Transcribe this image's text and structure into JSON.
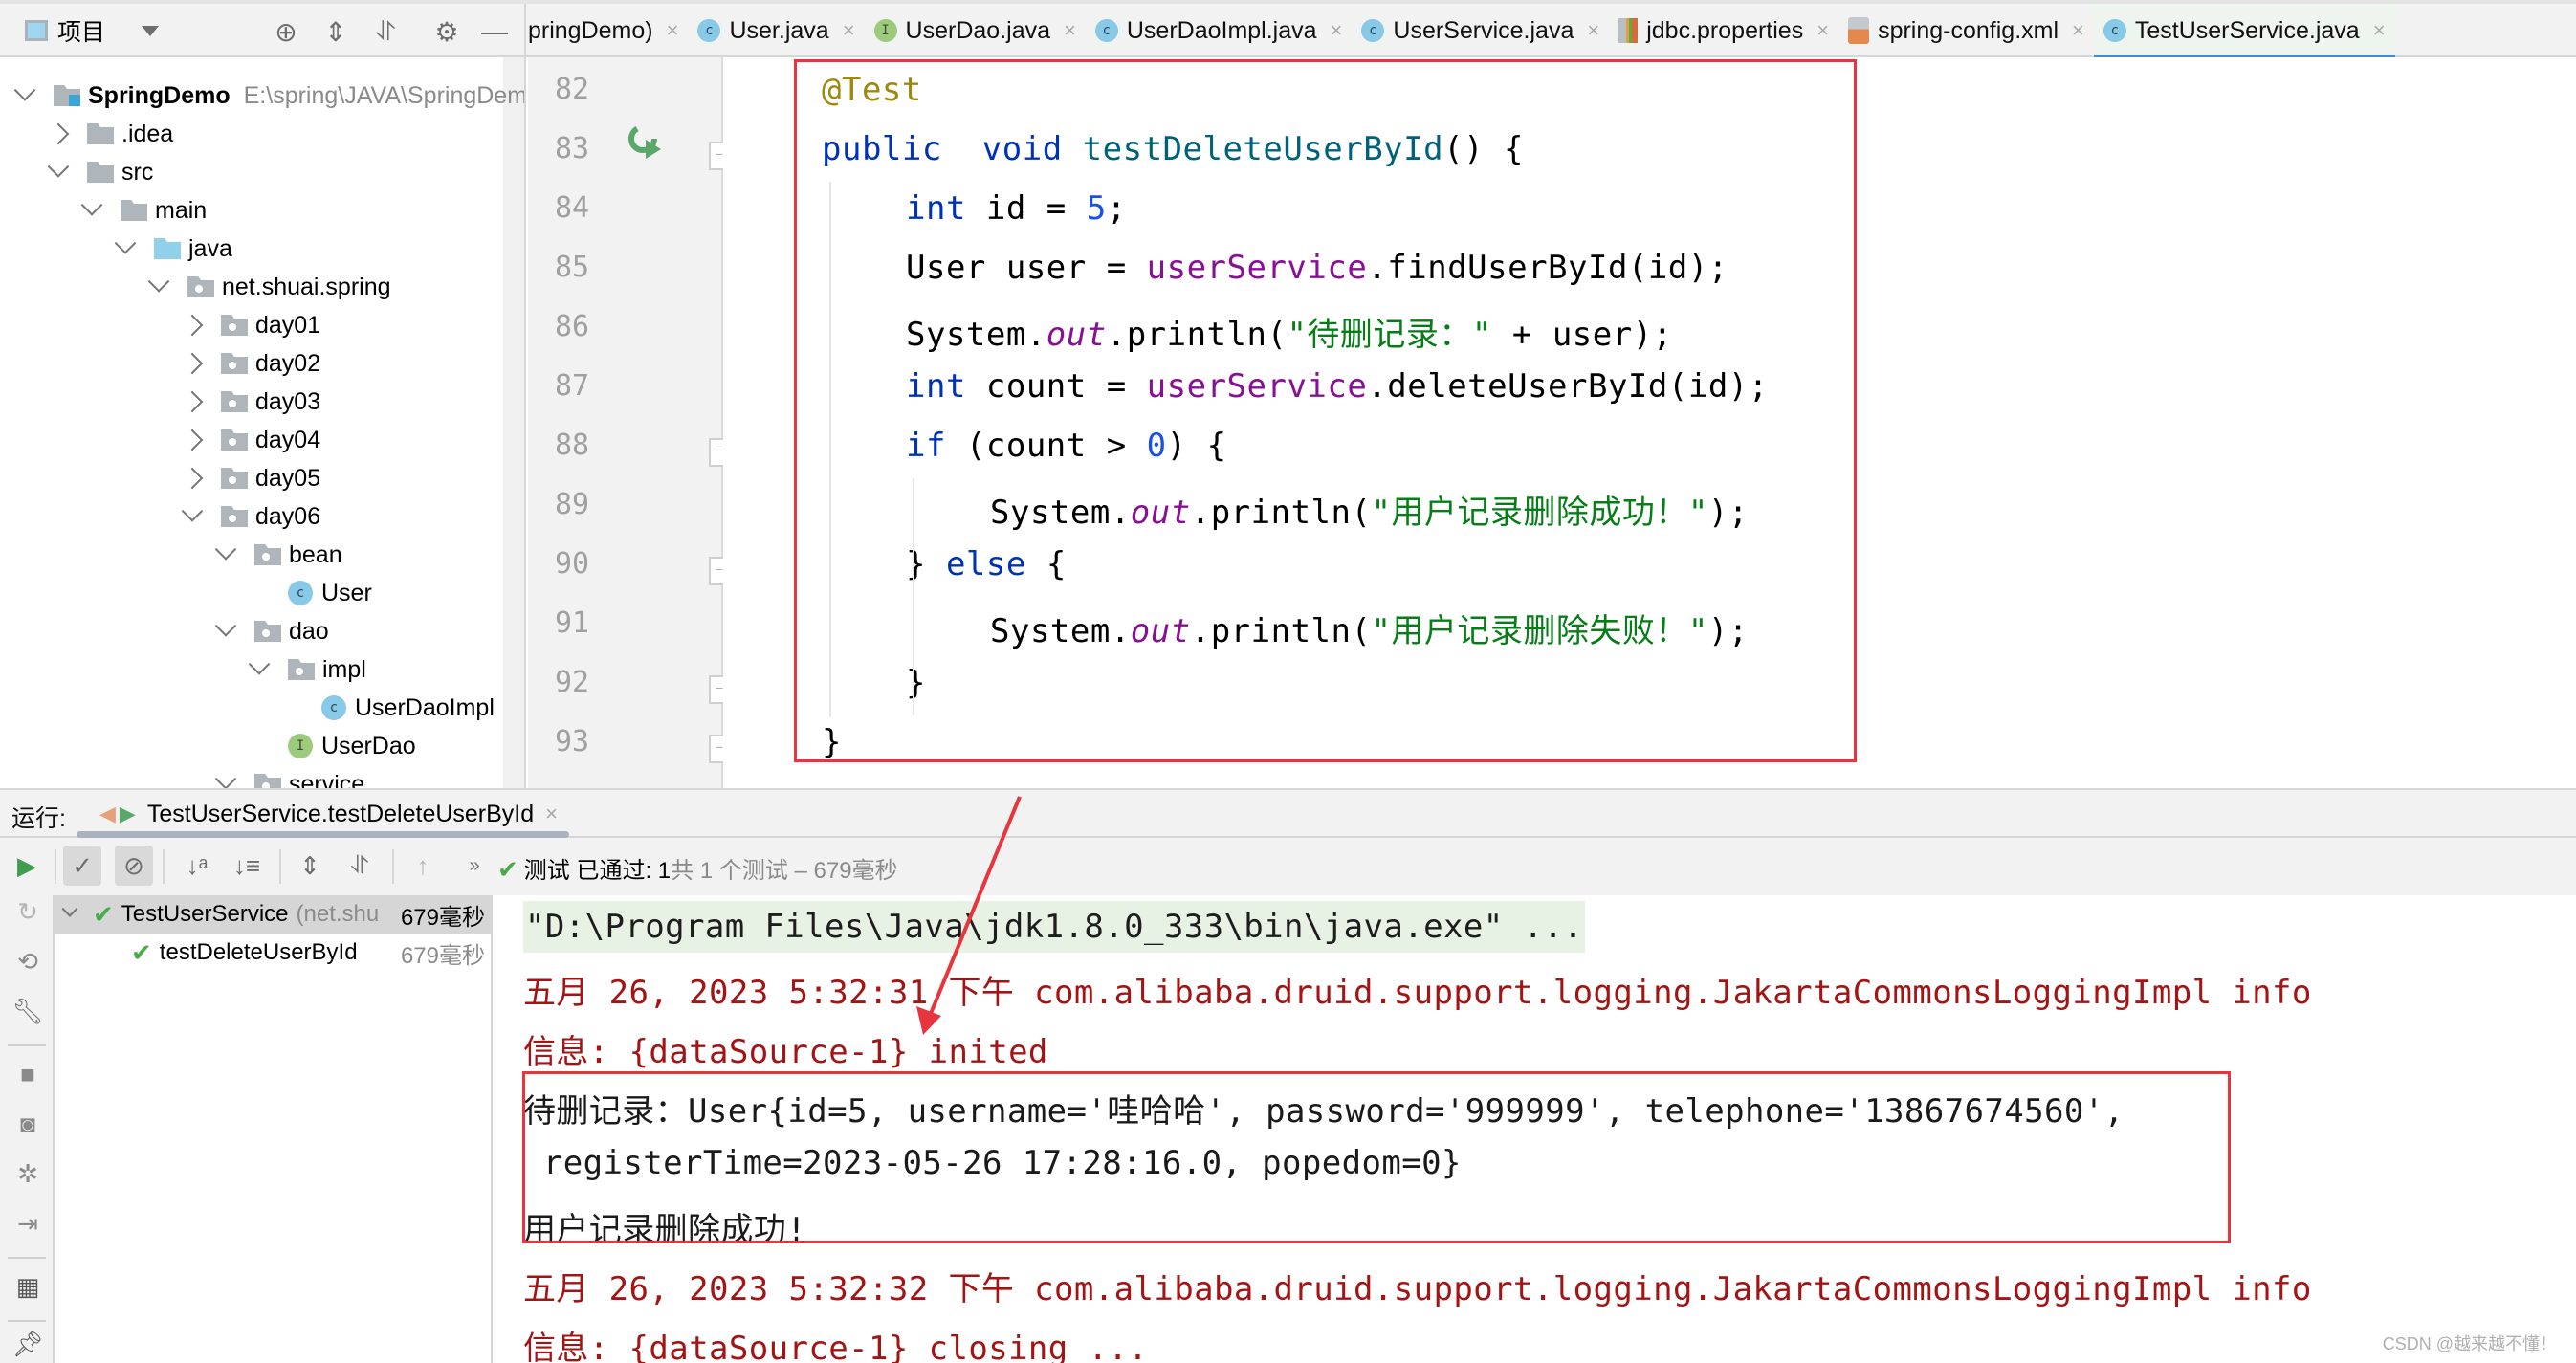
{
  "project_panel": {
    "title": "项目",
    "toolbar_icons": [
      "locate-icon",
      "expand-all-icon",
      "collapse-all-icon",
      "gear-icon",
      "minimize-icon"
    ],
    "tree": [
      {
        "label": "SpringDemo",
        "path": "E:\\spring\\JAVA\\SpringDem",
        "type": "module",
        "expanded": true,
        "depth": 0
      },
      {
        "label": ".idea",
        "type": "folder",
        "expanded": false,
        "depth": 1
      },
      {
        "label": "src",
        "type": "folder",
        "expanded": true,
        "depth": 1
      },
      {
        "label": "main",
        "type": "folder",
        "expanded": true,
        "depth": 2
      },
      {
        "label": "java",
        "type": "source-folder",
        "expanded": true,
        "depth": 3
      },
      {
        "label": "net.shuai.spring",
        "type": "package",
        "expanded": true,
        "depth": 4
      },
      {
        "label": "day01",
        "type": "package",
        "expanded": false,
        "depth": 5
      },
      {
        "label": "day02",
        "type": "package",
        "expanded": false,
        "depth": 5
      },
      {
        "label": "day03",
        "type": "package",
        "expanded": false,
        "depth": 5
      },
      {
        "label": "day04",
        "type": "package",
        "expanded": false,
        "depth": 5
      },
      {
        "label": "day05",
        "type": "package",
        "expanded": false,
        "depth": 5
      },
      {
        "label": "day06",
        "type": "package",
        "expanded": true,
        "depth": 5
      },
      {
        "label": "bean",
        "type": "package",
        "expanded": true,
        "depth": 6
      },
      {
        "label": "User",
        "type": "class",
        "depth": 7
      },
      {
        "label": "dao",
        "type": "package",
        "expanded": true,
        "depth": 6
      },
      {
        "label": "impl",
        "type": "package",
        "expanded": true,
        "depth": 7
      },
      {
        "label": "UserDaoImpl",
        "type": "class",
        "depth": 8
      },
      {
        "label": "UserDao",
        "type": "interface",
        "depth": 7
      },
      {
        "label": "service",
        "type": "package",
        "expanded": true,
        "depth": 6
      }
    ]
  },
  "editor_tabs": [
    {
      "label": "pringDemo)",
      "icon": "none",
      "active": false
    },
    {
      "label": "User.java",
      "icon": "class",
      "active": false
    },
    {
      "label": "UserDao.java",
      "icon": "interface",
      "active": false
    },
    {
      "label": "UserDaoImpl.java",
      "icon": "class",
      "active": false
    },
    {
      "label": "UserService.java",
      "icon": "class",
      "active": false
    },
    {
      "label": "jdbc.properties",
      "icon": "properties",
      "active": false
    },
    {
      "label": "spring-config.xml",
      "icon": "xml",
      "active": false
    },
    {
      "label": "TestUserService.java",
      "icon": "test-class",
      "active": true
    }
  ],
  "tab_close_glyph": "×",
  "editor": {
    "lines": [
      {
        "n": "82",
        "indent": 0,
        "tokens": [
          [
            "ann",
            "@Test"
          ]
        ]
      },
      {
        "n": "83",
        "indent": 0,
        "tokens": [
          [
            "kw",
            "public"
          ],
          [
            "",
            "  "
          ],
          [
            "kw",
            "void"
          ],
          [
            "",
            " "
          ],
          [
            "fn",
            "testDeleteUserById"
          ],
          [
            "",
            "() {"
          ]
        ]
      },
      {
        "n": "84",
        "indent": 1,
        "tokens": [
          [
            "kw",
            "int"
          ],
          [
            "",
            " id = "
          ],
          [
            "num",
            "5"
          ],
          [
            "",
            ";"
          ]
        ]
      },
      {
        "n": "85",
        "indent": 1,
        "tokens": [
          [
            "",
            "User user = "
          ],
          [
            "fld",
            "userService"
          ],
          [
            "",
            ".findUserById(id);"
          ]
        ]
      },
      {
        "n": "86",
        "indent": 1,
        "tokens": [
          [
            "",
            "System."
          ],
          [
            "sf",
            "out"
          ],
          [
            "",
            ".println("
          ],
          [
            "str",
            "\"待删记录：\""
          ],
          [
            "",
            " + user);"
          ]
        ]
      },
      {
        "n": "87",
        "indent": 1,
        "tokens": [
          [
            "kw",
            "int"
          ],
          [
            "",
            " count = "
          ],
          [
            "fld",
            "userService"
          ],
          [
            "",
            ".deleteUserById(id);"
          ]
        ]
      },
      {
        "n": "88",
        "indent": 1,
        "tokens": [
          [
            "kw",
            "if"
          ],
          [
            "",
            " (count > "
          ],
          [
            "num",
            "0"
          ],
          [
            "",
            ") {"
          ]
        ]
      },
      {
        "n": "89",
        "indent": 2,
        "tokens": [
          [
            "",
            "System."
          ],
          [
            "sf",
            "out"
          ],
          [
            "",
            ".println("
          ],
          [
            "str",
            "\"用户记录删除成功！\""
          ],
          [
            "",
            ");"
          ]
        ]
      },
      {
        "n": "90",
        "indent": 1,
        "tokens": [
          [
            "",
            "} "
          ],
          [
            "kw",
            "else"
          ],
          [
            "",
            " {"
          ]
        ]
      },
      {
        "n": "91",
        "indent": 2,
        "tokens": [
          [
            "",
            "System."
          ],
          [
            "sf",
            "out"
          ],
          [
            "",
            ".println("
          ],
          [
            "str",
            "\"用户记录删除失败！\""
          ],
          [
            "",
            ");"
          ]
        ]
      },
      {
        "n": "92",
        "indent": 1,
        "tokens": [
          [
            "",
            "}"
          ]
        ]
      },
      {
        "n": "93",
        "indent": 0,
        "tokens": [
          [
            "",
            "}"
          ]
        ]
      }
    ]
  },
  "run_panel": {
    "label": "运行:",
    "tab_label": "TestUserService.testDeleteUserById",
    "status_prefix": "测试 已通过: 1",
    "status_suffix": "共 1 个测试 – 679毫秒",
    "tests": [
      {
        "label": "TestUserService",
        "sub": "(net.shu",
        "time": "679毫秒",
        "selected": true,
        "passed": true
      },
      {
        "label": "testDeleteUserById",
        "sub": "",
        "time": "679毫秒",
        "selected": false,
        "passed": true
      }
    ],
    "console": [
      {
        "kind": "cmd",
        "text": "\"D:\\Program Files\\Java\\jdk1.8.0_333\\bin\\java.exe\" ..."
      },
      {
        "kind": "err",
        "text": "五月 26, 2023 5:32:31 下午 com.alibaba.druid.support.logging.JakartaCommonsLoggingImpl info"
      },
      {
        "kind": "err",
        "text": "信息: {dataSource-1} inited"
      },
      {
        "kind": "out",
        "text": "待删记录：User{id=5, username='哇哈哈', password='999999', telephone='13867674560',"
      },
      {
        "kind": "out",
        "text": " registerTime=2023-05-26 17:28:16.0, popedom=0}"
      },
      {
        "kind": "out",
        "text": "用户记录删除成功!"
      },
      {
        "kind": "err",
        "text": "五月 26, 2023 5:32:32 下午 com.alibaba.druid.support.logging.JakartaCommonsLoggingImpl info"
      },
      {
        "kind": "err",
        "text": "信息: {dataSource-1} closing ..."
      }
    ]
  },
  "annotation_color": "#e8343c",
  "watermark": "CSDN @越来越不懂！"
}
